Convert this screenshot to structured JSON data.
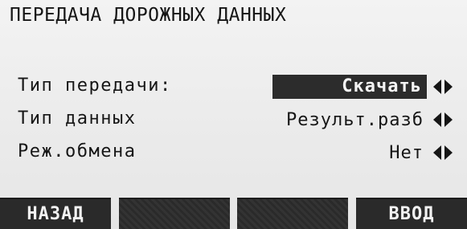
{
  "screen": {
    "title": "ПЕРЕДАЧА ДОРОЖНЫХ ДАННЫХ"
  },
  "fields": [
    {
      "label": "Тип передачи:",
      "value": "Скачать",
      "selected": true,
      "arrows_icon": "left-right-arrows-icon"
    },
    {
      "label": "Тип данных",
      "value": "Результ.разб",
      "selected": false,
      "arrows_icon": "left-right-arrows-icon"
    },
    {
      "label": "Реж.обмена",
      "value": "Нет",
      "selected": false,
      "arrows_icon": "left-right-arrows-icon"
    }
  ],
  "softkeys": [
    {
      "label": "НАЗАД"
    },
    {
      "label": ""
    },
    {
      "label": ""
    },
    {
      "label": "ВВОД"
    }
  ],
  "colors": {
    "background": "#ececec",
    "text": "#161616",
    "highlight": "#2c2c2c",
    "softkey": "#2a2a2a"
  }
}
